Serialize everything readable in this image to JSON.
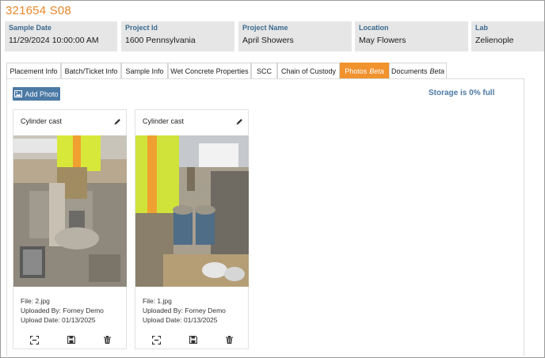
{
  "header": {
    "title": "321654 S08"
  },
  "info": [
    {
      "label": "Sample Date",
      "value": "11/29/2024 10:00:00 AM"
    },
    {
      "label": "Project Id",
      "value": "1600 Pennsylvania"
    },
    {
      "label": "Project Name",
      "value": "April Showers"
    },
    {
      "label": "Location",
      "value": "May Flowers"
    },
    {
      "label": "Lab",
      "value": "Zelienople"
    }
  ],
  "tabs": [
    {
      "label": "Placement Info"
    },
    {
      "label": "Batch/Ticket Info"
    },
    {
      "label": "Sample Info"
    },
    {
      "label": "Wet Concrete Properties"
    },
    {
      "label": "SCC"
    },
    {
      "label": "Chain of Custody"
    },
    {
      "label": "Photos",
      "badge": "Beta",
      "active": true
    },
    {
      "label": "Documents",
      "badge": "Beta"
    }
  ],
  "toolbar": {
    "add_photo_label": "Add Photo",
    "storage_text": "Storage is 0% full"
  },
  "photos": [
    {
      "caption": "Cylinder cast",
      "file": "File: 2.jpg",
      "uploaded_by": "Uploaded By: Forney Demo",
      "upload_date": "Upload Date: 01/13/2025"
    },
    {
      "caption": "Cylinder cast",
      "file": "File: 1.jpg",
      "uploaded_by": "Uploaded By: Forney Demo",
      "upload_date": "Upload Date: 01/13/2025"
    }
  ],
  "icons": {
    "edit": "pencil-icon",
    "expand": "expand-icon",
    "save": "floppy-disk-icon",
    "delete": "trash-icon",
    "add": "image-icon"
  },
  "colors": {
    "accent": "#f0922e",
    "title": "#e8862a",
    "primary": "#4b7aa5",
    "label": "#3b6a8f",
    "infoBg": "#e6e6e6"
  }
}
